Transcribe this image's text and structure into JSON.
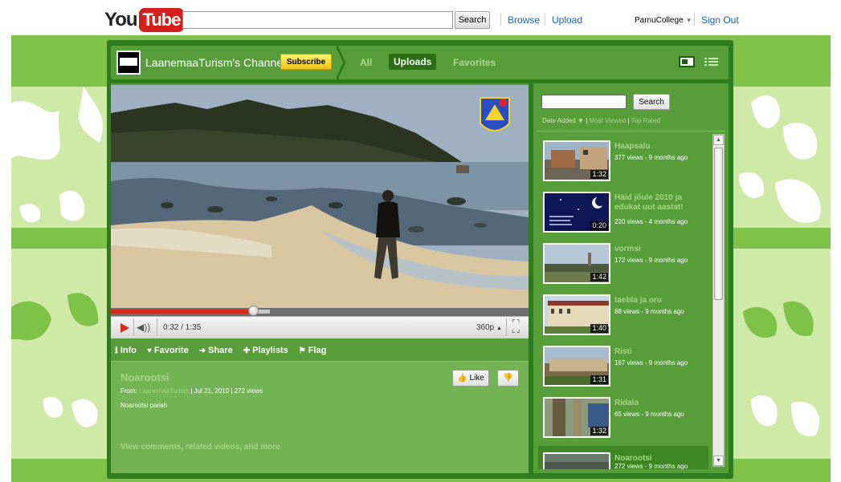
{
  "header": {
    "logo_you": "You",
    "logo_tube": "Tube",
    "search_button": "Search",
    "browse": "Browse",
    "upload": "Upload",
    "username": "ParnuCollege",
    "sign_out": "Sign Out"
  },
  "channel": {
    "title": "LaanemaaTurism's Channel",
    "subscribe": "Subscribe",
    "tabs": [
      {
        "label": "All"
      },
      {
        "label": "Uploads"
      },
      {
        "label": "Favorites"
      }
    ]
  },
  "player": {
    "time": "0:32 / 1:35",
    "quality": "360p",
    "progress": 0.34,
    "loaded": 0.38
  },
  "video_tabs": [
    {
      "icon": "ℹ",
      "label": "Info"
    },
    {
      "icon": "♥",
      "label": "Favorite"
    },
    {
      "icon": "➜",
      "label": "Share"
    },
    {
      "icon": "✚",
      "label": "Playlists"
    },
    {
      "icon": "⚑",
      "label": "Flag"
    }
  ],
  "video_info": {
    "title": "Noarootsi",
    "from_label": "From:",
    "from_user": "LaanemaaTurism",
    "date_views": "| Jul 21, 2010  | 272 views",
    "description": "Noarootsi parish",
    "more_link": "View comments, related videos, and more",
    "like": "Like"
  },
  "sidebar": {
    "search_button": "Search",
    "sort": {
      "date_added": "Date Added",
      "most_viewed": "Most Viewed",
      "top_rated": "Top Rated"
    },
    "videos": [
      {
        "title": "Haapsalu",
        "meta": "377 views - 9 months ago",
        "duration": "1:32"
      },
      {
        "title": "Häid jõule 2010 ja edukat uut aastat!",
        "meta": "220 views - 4 months ago",
        "duration": "0:20"
      },
      {
        "title": "vormsi",
        "meta": "172 views - 9 months ago",
        "duration": "1:42"
      },
      {
        "title": "taebla ja oru",
        "meta": "88 views - 9 months ago",
        "duration": "1:40"
      },
      {
        "title": "Risti",
        "meta": "167 views - 9 months ago",
        "duration": "1:31"
      },
      {
        "title": "Ridala",
        "meta": "65 views - 9 months ago",
        "duration": "1:32"
      },
      {
        "title": "Noarootsi",
        "meta": "272 views - 9 months ago",
        "duration": ""
      }
    ]
  },
  "colors": {
    "frame": "#2f7c1f",
    "panel": "#579e3a",
    "accent_link": "#a3d586",
    "youtube_red": "#d4201c"
  }
}
